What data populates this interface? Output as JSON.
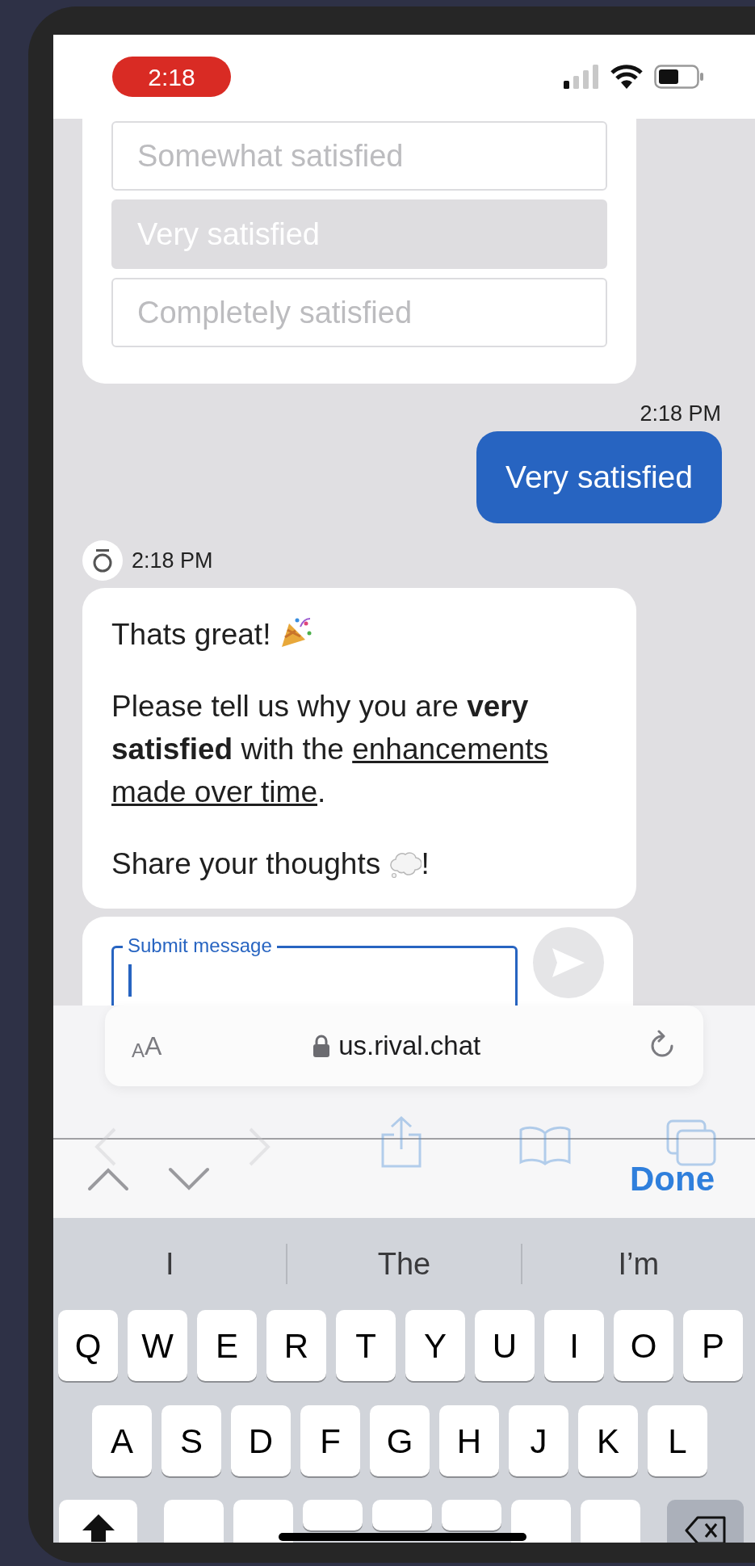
{
  "status_bar": {
    "time": "2:18"
  },
  "survey_options": [
    {
      "label": "Somewhat satisfied",
      "selected": false
    },
    {
      "label": "Very satisfied",
      "selected": true
    },
    {
      "label": "Completely satisfied",
      "selected": false
    }
  ],
  "messages": [
    {
      "kind": "user",
      "time": "2:18 PM",
      "text": "Very satisfied"
    },
    {
      "kind": "bot",
      "time": "2:18 PM",
      "paragraphs": [
        [
          {
            "kind": "text",
            "text": "Thats great! "
          },
          {
            "kind": "popper"
          }
        ],
        [
          {
            "kind": "text",
            "text": "Please tell us why you are **very satisfied** with the "
          },
          {
            "kind": "underline",
            "text": "enhancements made over time"
          },
          {
            "kind": "text",
            "text": "."
          }
        ],
        [
          {
            "kind": "text",
            "text": "Share your thoughts "
          },
          {
            "kind": "cloud"
          },
          {
            "kind": "text",
            "text": "!"
          }
        ]
      ]
    }
  ],
  "composer": {
    "label": "Submit message",
    "send_disabled": true
  },
  "browser": {
    "text_size": "AA",
    "url": "us.rival.chat",
    "done": "Done"
  },
  "keyboard": {
    "suggestions": [
      "I",
      "The",
      "I’m"
    ],
    "rows": [
      [
        "Q",
        "W",
        "E",
        "R",
        "T",
        "Y",
        "U",
        "I",
        "O",
        "P"
      ],
      [
        "A",
        "S",
        "D",
        "F",
        "G",
        "H",
        "J",
        "K",
        "L"
      ]
    ]
  }
}
